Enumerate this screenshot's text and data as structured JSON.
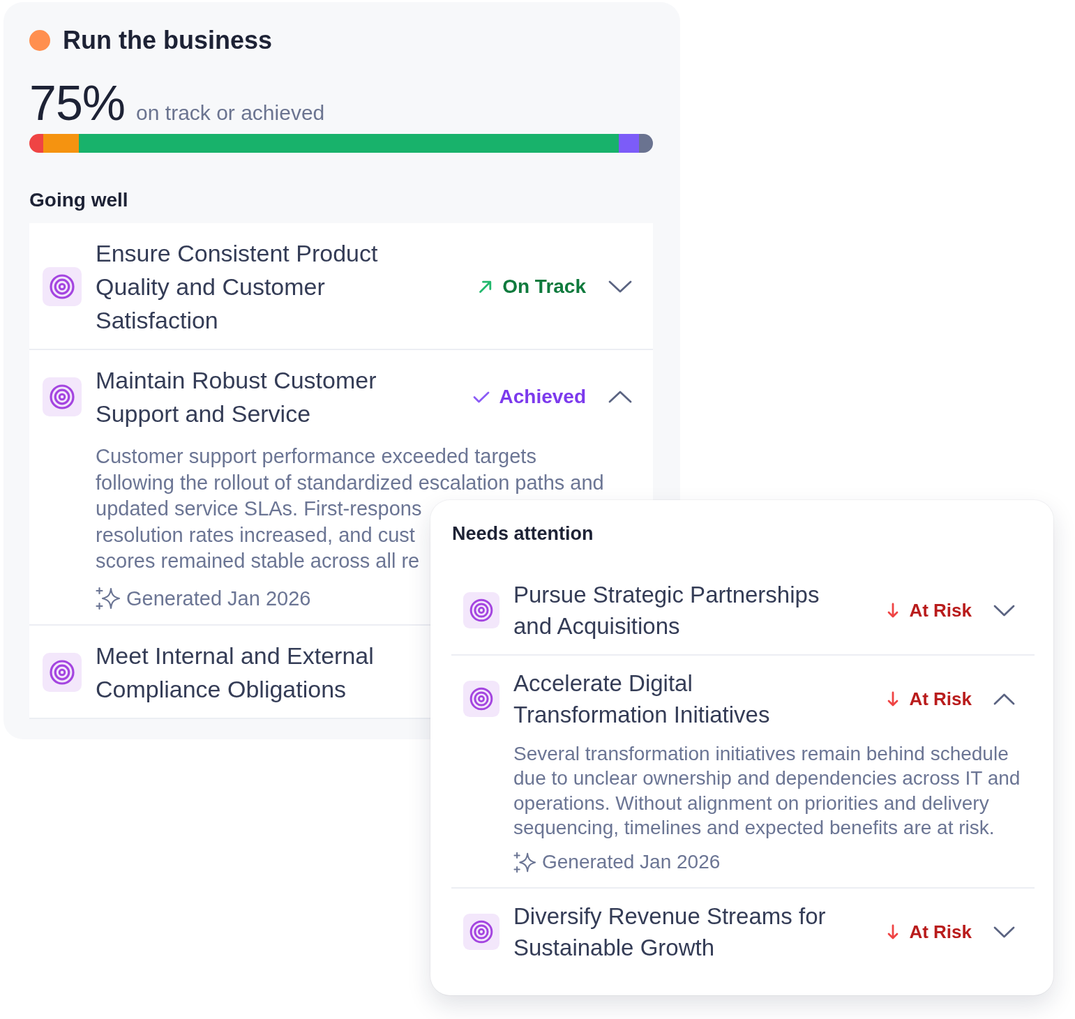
{
  "summary": {
    "title": "Run the business",
    "percent": "75%",
    "caption": "on track or achieved"
  },
  "going_well": {
    "heading": "Going well",
    "goals": [
      {
        "title": "Ensure Consistent Product Quality and Customer Satisfaction",
        "status": {
          "kind": "on_track",
          "label": "On Track"
        },
        "expanded": false
      },
      {
        "title": "Maintain Robust Customer Support and Service",
        "status": {
          "kind": "achieved",
          "label": "Achieved"
        },
        "expanded": true,
        "description_lines": [
          "Customer support performance exceeded targets",
          "following the rollout of standardized escalation paths and",
          "updated service SLAs. First-respons",
          "resolution rates increased, and cust",
          "scores remained stable across all re"
        ],
        "generated": "Generated Jan 2026"
      },
      {
        "title": "Meet Internal and External Compliance Obligations"
      }
    ]
  },
  "needs_attention": {
    "heading": "Needs attention",
    "goals": [
      {
        "title": "Pursue Strategic Partnerships and Acquisitions",
        "status": {
          "kind": "at_risk",
          "label": "At Risk"
        },
        "expanded": false
      },
      {
        "title": "Accelerate Digital Transformation Initiatives",
        "status": {
          "kind": "at_risk",
          "label": "At Risk"
        },
        "expanded": true,
        "description": "Several transformation initiatives remain behind schedule due to unclear ownership and dependencies across IT and operations. Without alignment on priorities and delivery sequencing, timelines and expected benefits are at risk.",
        "generated": "Generated Jan 2026"
      },
      {
        "title": "Diversify Revenue Streams for Sustainable Growth",
        "status": {
          "kind": "at_risk",
          "label": "At Risk"
        },
        "expanded": false
      }
    ]
  }
}
